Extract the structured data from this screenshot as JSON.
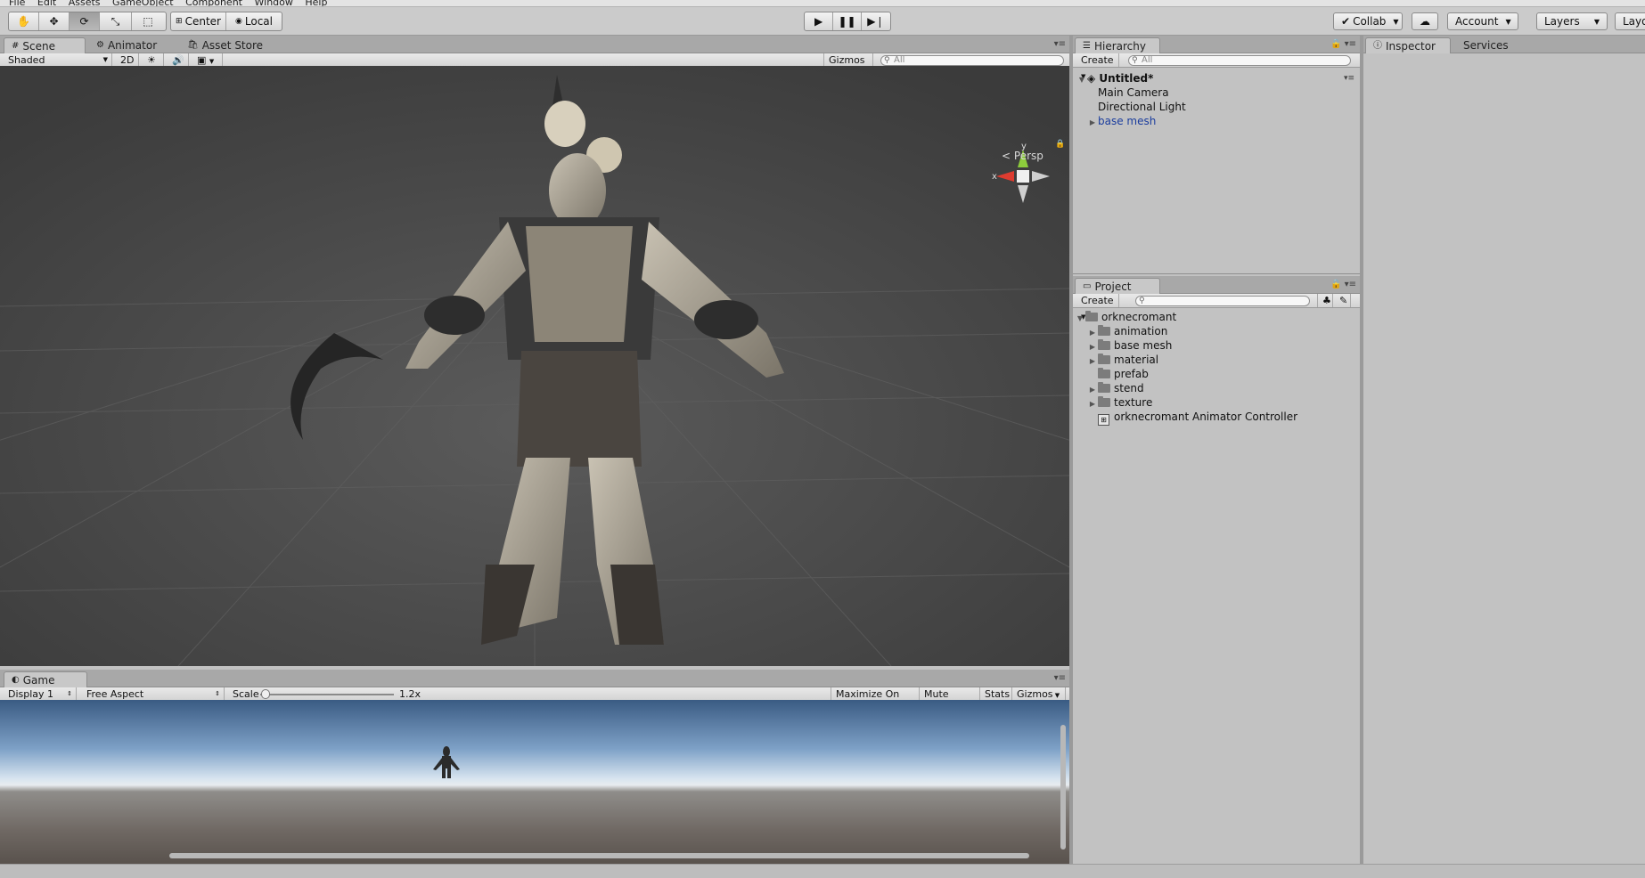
{
  "menu": [
    "File",
    "Edit",
    "Assets",
    "GameObject",
    "Component",
    "Window",
    "Help"
  ],
  "toolbar": {
    "tools": [
      "hand-icon",
      "move-icon",
      "rotate-icon",
      "scale-icon",
      "rect-tool-icon"
    ],
    "pivot_center": "Center",
    "pivot_local": "Local",
    "collab": "Collab",
    "account": "Account",
    "layers": "Layers",
    "layout": "Layo"
  },
  "scene": {
    "tabs": [
      "Scene",
      "Animator",
      "Asset Store"
    ],
    "shading": "Shaded",
    "mode_2d": "2D",
    "gizmos": "Gizmos",
    "search_placeholder": "All",
    "persp": "Persp",
    "axis_x": "x",
    "axis_y": "y"
  },
  "game": {
    "tab": "Game",
    "display": "Display 1",
    "aspect": "Free Aspect",
    "scale_label": "Scale",
    "scale_value": "1.2x",
    "scale_fraction": 0.04,
    "maximize": "Maximize On Play",
    "mute": "Mute Audio",
    "stats": "Stats",
    "gizmos": "Gizmos"
  },
  "hierarchy": {
    "tab": "Hierarchy",
    "create": "Create",
    "search_placeholder": "All",
    "scene_name": "Untitled*",
    "items": [
      "Main Camera",
      "Directional Light",
      "base mesh"
    ]
  },
  "project": {
    "tab": "Project",
    "create": "Create",
    "root": "orknecromant",
    "folders": [
      "animation",
      "base mesh",
      "material",
      "prefab",
      "stend",
      "texture"
    ],
    "controller": "orknecromant Animator Controller"
  },
  "inspector": {
    "tab": "Inspector",
    "services": "Services"
  },
  "colors": {
    "scene_bg": "#474747",
    "panel_bg": "#c2c2c2",
    "prefab_blue": "#1b3d9e"
  }
}
